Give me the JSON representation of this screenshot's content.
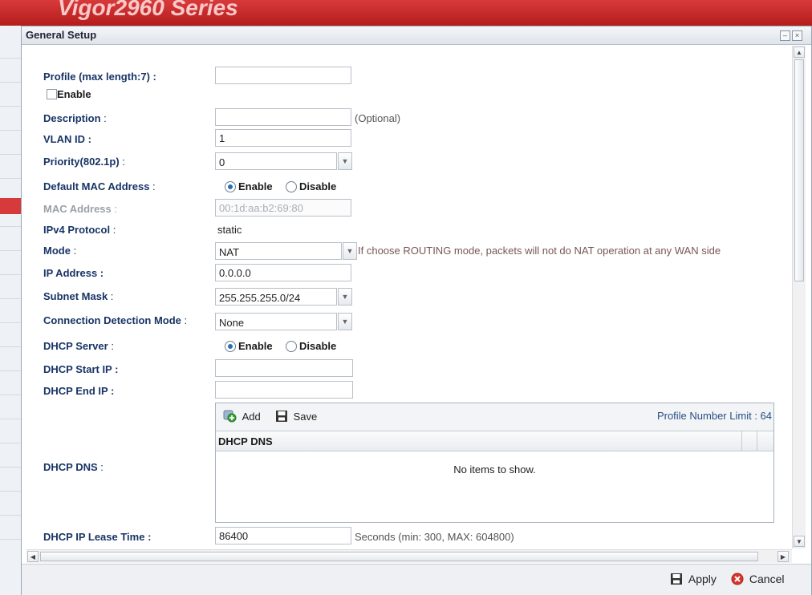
{
  "background": {
    "brand": "Vigor2960 Series"
  },
  "dialog": {
    "title": "General Setup",
    "minimize_glyph": "–",
    "close_glyph": "×"
  },
  "form": {
    "profile": {
      "label": "Profile (max length:7) :",
      "value": ""
    },
    "enable": {
      "label": "Enable",
      "checked": false
    },
    "description": {
      "label": "Description",
      "colon": " :",
      "value": "",
      "hint": "(Optional)"
    },
    "vlan_id": {
      "label": "VLAN ID :",
      "value": "1"
    },
    "priority": {
      "label": "Priority(802.1p)",
      "colon": " :",
      "value": "0"
    },
    "default_mac": {
      "label": "Default MAC Address",
      "colon": " :",
      "option_enable": "Enable",
      "option_disable": "Disable",
      "selected": "Enable"
    },
    "mac_address": {
      "label": "MAC Address",
      "colon": " :",
      "value": "00:1d:aa:b2:69:80"
    },
    "ipv4_protocol": {
      "label": "IPv4 Protocol",
      "colon": " :",
      "value": "static"
    },
    "mode": {
      "label": "Mode",
      "colon": " :",
      "value": "NAT",
      "hint": "If choose ROUTING mode, packets will not do NAT operation at any WAN side"
    },
    "ip_address": {
      "label": "IP Address :",
      "value": "0.0.0.0"
    },
    "subnet_mask": {
      "label": "Subnet Mask",
      "colon": " :",
      "value": "255.255.255.0/24"
    },
    "connection_detection": {
      "label": "Connection Detection Mode",
      "colon": " :",
      "value": "None"
    },
    "dhcp_server": {
      "label": "DHCP Server",
      "colon": " :",
      "option_enable": "Enable",
      "option_disable": "Disable",
      "selected": "Enable"
    },
    "dhcp_start_ip": {
      "label": "DHCP Start IP :",
      "value": ""
    },
    "dhcp_end_ip": {
      "label": "DHCP End IP :",
      "value": ""
    },
    "dhcp_dns": {
      "label": "DHCP DNS",
      "colon": " :",
      "add_label": "Add",
      "save_label": "Save",
      "limit_label": "Profile Number Limit : 64",
      "column_header": "DHCP DNS",
      "empty_text": "No items to show."
    },
    "lease_time": {
      "label": "DHCP IP Lease Time :",
      "value": "86400",
      "hint": "Seconds (min: 300, MAX: 604800)"
    }
  },
  "footer": {
    "apply_label": "Apply",
    "cancel_label": "Cancel"
  },
  "colors": {
    "label": "#183466",
    "accent": "#2a6cb8",
    "brand_red": "#c62828",
    "hint": "#7a5656"
  }
}
